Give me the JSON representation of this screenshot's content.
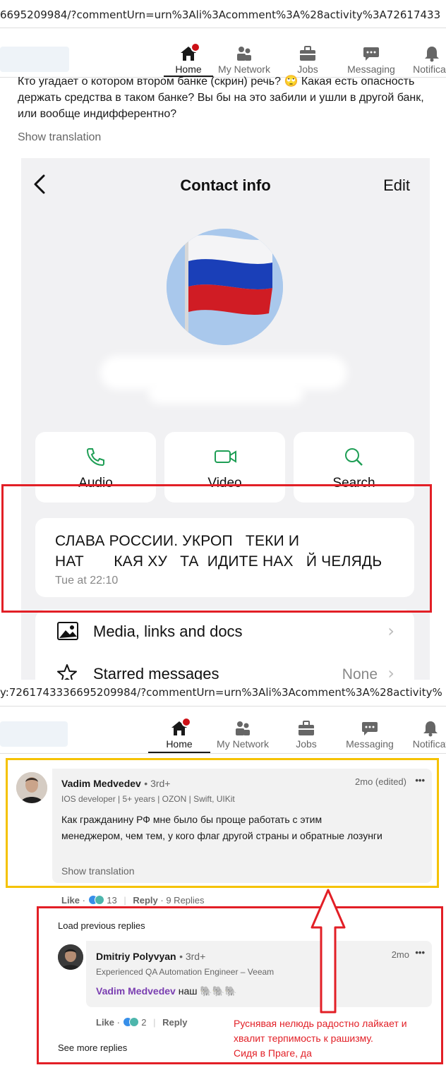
{
  "top": {
    "url": "6695209984/?commentUrn=urn%3Ali%3Acomment%3A%28activity%3A72617433",
    "nav": {
      "home": "Home",
      "network": "My Network",
      "jobs": "Jobs",
      "messaging": "Messaging",
      "notifications": "Notificati"
    },
    "post_text": "Кто угадает о котором втором банке (скрин) речь? 🙄 Какая есть опасность держать средства в таком банке? Вы бы на это забили и ушли в другой банк, или вообще индифферентно?",
    "show_translation": "Show translation"
  },
  "phone": {
    "back": "‹",
    "title": "Contact info",
    "edit": "Edit",
    "actions": [
      {
        "label": "Audio"
      },
      {
        "label": "Video"
      },
      {
        "label": "Search"
      }
    ],
    "status_line1": "СЛАВА РОССИИ. УКРОП   ТЕКИ И",
    "status_line2": "НАТ       КАЯ ХУ   ТА  ИДИТЕ НАХ   Й ЧЕЛЯДЬ",
    "status_date": "Tue at 22:10",
    "rows": [
      {
        "label": "Media, links and docs",
        "value": ""
      },
      {
        "label": "Starred messages",
        "value": "None"
      }
    ]
  },
  "bottom": {
    "url": "y:7261743336695209984/?commentUrn=urn%3Ali%3Acomment%3A%28activity%",
    "nav": {
      "home": "Home",
      "network": "My Network",
      "jobs": "Jobs",
      "messaging": "Messaging",
      "notifications": "Notificat"
    }
  },
  "comment1": {
    "name": "Vadim Medvedev",
    "degree": "• 3rd+",
    "headline": "IOS developer | 5+ years | OZON | Swift, UIKit",
    "time": "2mo (edited)",
    "more": "•••",
    "text": "Как гражданину РФ мне было бы проще работать с этим менеджером, чем тем, у кого флаг другой страны и обратные лозунги",
    "show_translation": "Show translation",
    "like": "Like",
    "sep": "·",
    "reactions": "13",
    "reply": "Reply",
    "replies": "9 Replies"
  },
  "replies": {
    "load_previous": "Load previous replies",
    "see_more": "See more replies"
  },
  "comment2": {
    "name": "Dmitriy Polyvyan",
    "degree": "• 3rd+",
    "headline": "Experienced QA Automation Engineer – Veeam",
    "time": "2mo",
    "more": "•••",
    "mention": "Vadim Medvedev",
    "text": "наш 🐘🐘🐘",
    "like": "Like",
    "sep": "·",
    "reactions": "2",
    "reply": "Reply"
  },
  "annotation": {
    "line1": "Руснявая нелюдь радостно лайкает и",
    "line2": "хвалит терпимость к рашизму.",
    "line3": "Сидя в Праге, да"
  },
  "colors": {
    "highlight_red": "#e21f26",
    "highlight_yellow": "#f5c200",
    "whatsapp_green": "#1e9e55",
    "mention_purple": "#7a3eb1"
  }
}
